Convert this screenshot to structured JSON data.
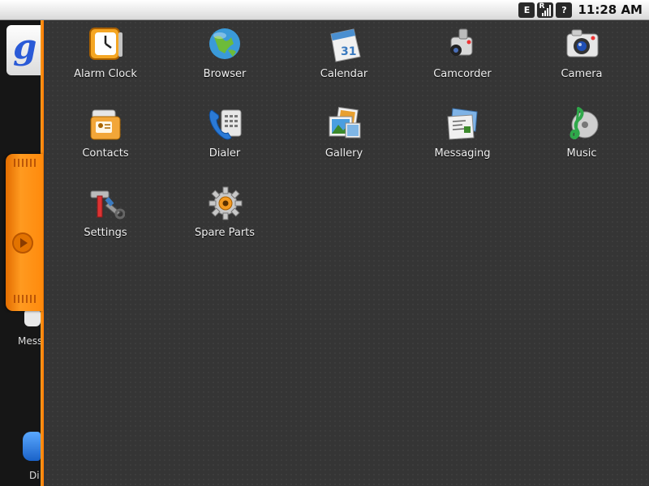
{
  "status_bar": {
    "data_type": "E",
    "roaming": "R",
    "unknown": "?",
    "time": "11:28 AM"
  },
  "home": {
    "partial_labels": [
      "Mess",
      "Di"
    ]
  },
  "apps": [
    {
      "label": "Alarm Clock",
      "icon": "alarm-clock-icon"
    },
    {
      "label": "Browser",
      "icon": "globe-icon"
    },
    {
      "label": "Calendar",
      "icon": "calendar-icon",
      "badge": "31"
    },
    {
      "label": "Camcorder",
      "icon": "camcorder-icon"
    },
    {
      "label": "Camera",
      "icon": "camera-icon"
    },
    {
      "label": "Contacts",
      "icon": "contacts-icon"
    },
    {
      "label": "Dialer",
      "icon": "phone-icon"
    },
    {
      "label": "Gallery",
      "icon": "gallery-icon"
    },
    {
      "label": "Messaging",
      "icon": "messaging-icon"
    },
    {
      "label": "Music",
      "icon": "music-icon"
    },
    {
      "label": "Settings",
      "icon": "settings-icon"
    },
    {
      "label": "Spare Parts",
      "icon": "gear-icon"
    }
  ],
  "colors": {
    "drawer_bg": "#353535",
    "accent_orange": "#ff8a0c"
  }
}
